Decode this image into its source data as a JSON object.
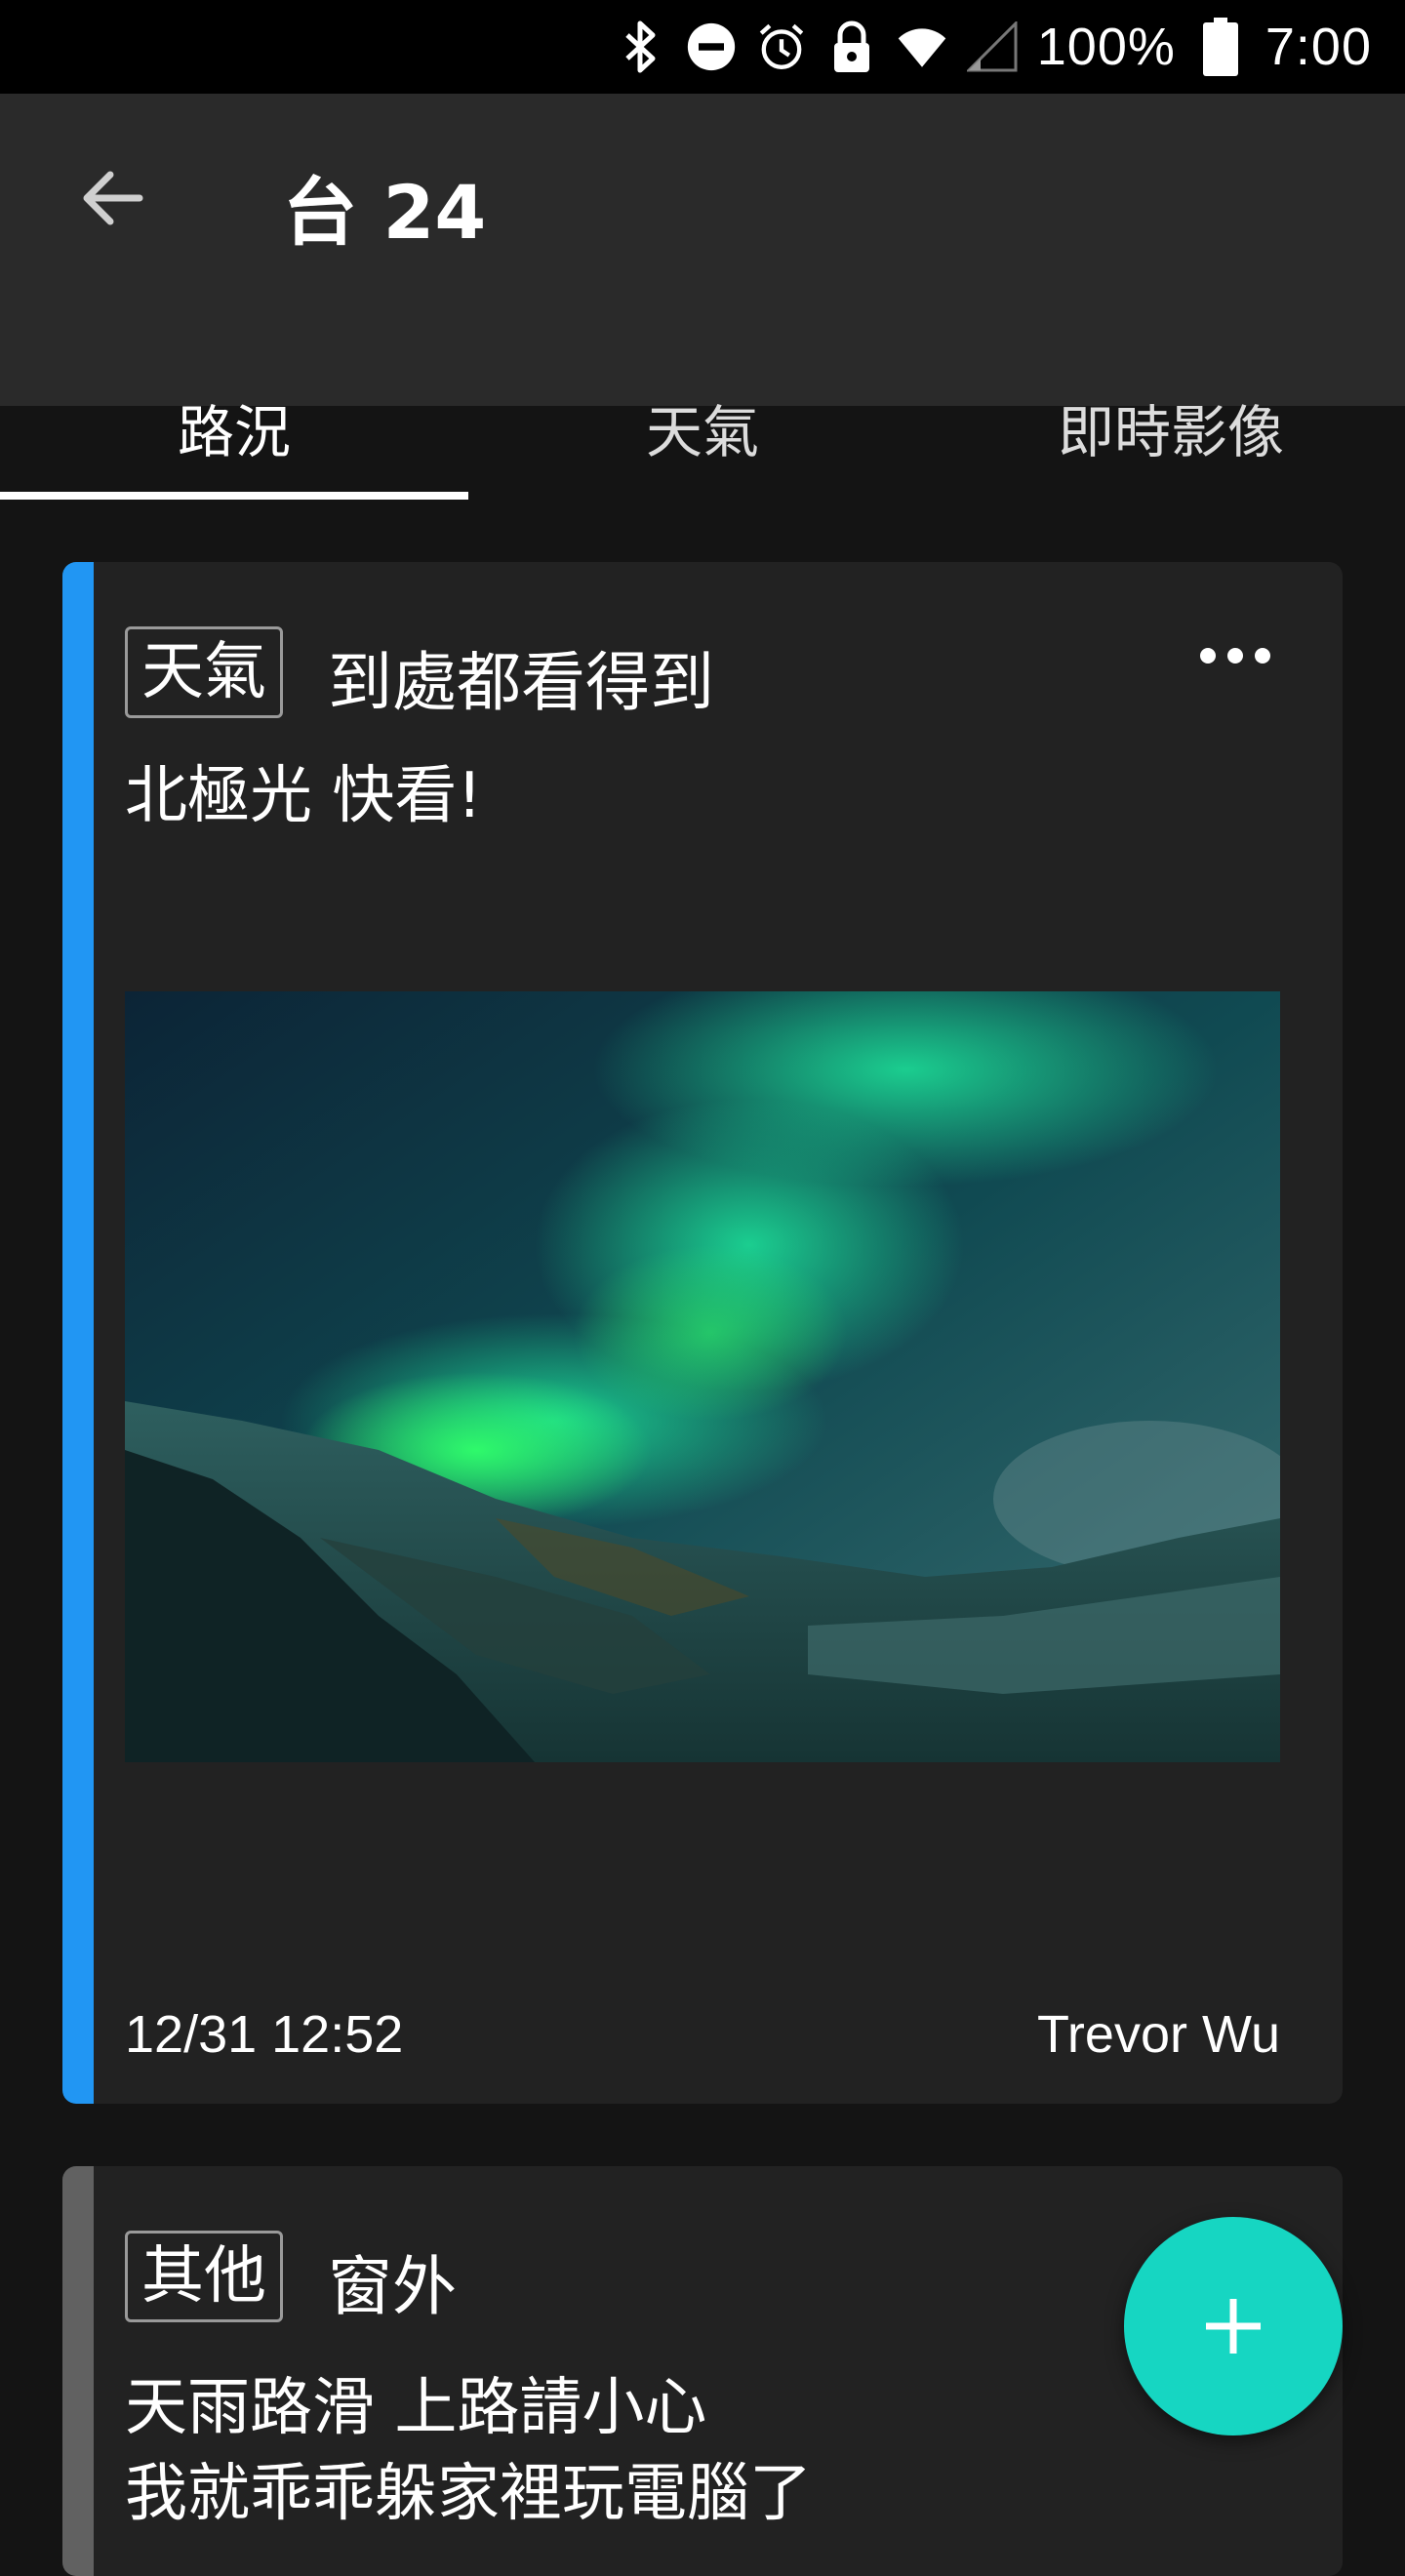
{
  "status_bar": {
    "battery_text": "100%",
    "time": "7:00",
    "icons": [
      "bluetooth-icon",
      "do-not-disturb-icon",
      "alarm-icon",
      "lock-icon",
      "wifi-icon",
      "cell-signal-icon",
      "battery-icon"
    ]
  },
  "app_bar": {
    "title": "台 24",
    "back_icon": "arrow-back-icon"
  },
  "tabs": [
    {
      "label": "路況",
      "active": true
    },
    {
      "label": "天氣",
      "active": false
    },
    {
      "label": "即時影像",
      "active": false
    }
  ],
  "posts": [
    {
      "tag": "天氣",
      "headline": "到處都看得到",
      "body": "北極光 快看!",
      "has_image": true,
      "image_subject": "aurora-photo",
      "timestamp": "12/31 12:52",
      "author": "Trevor Wu",
      "accent_color": "#2196F3"
    },
    {
      "tag": "其他",
      "headline": "窗外",
      "body": "天雨路滑 上路請小心\n我就乖乖躲家裡玩電腦了",
      "accent_color": "#616161"
    }
  ],
  "fab": {
    "icon": "plus-icon",
    "color": "#16D6C2"
  },
  "colors": {
    "background": "#141414",
    "app_bar": "#2A2A2A",
    "card": "#222222"
  }
}
